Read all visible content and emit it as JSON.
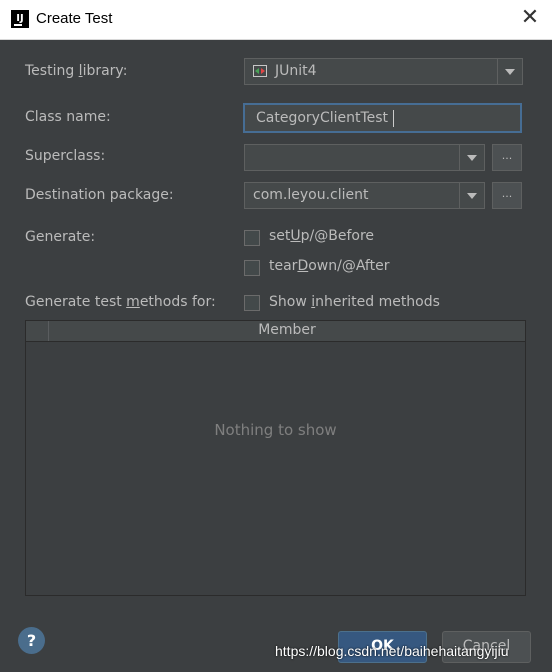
{
  "window": {
    "title": "Create Test",
    "close_glyph": "✕",
    "app_icon_letters": "IJ"
  },
  "fields": {
    "testing_library": {
      "label_pre": "Testing ",
      "label_mn": "l",
      "label_post": "ibrary:",
      "value": "JUnit4",
      "icon": "junit-icon"
    },
    "class_name": {
      "label": "Class name:",
      "value": "CategoryClientTest"
    },
    "superclass": {
      "label": "Superclass:",
      "value": "",
      "more_label": "..."
    },
    "destination_package": {
      "label": "Destination package:",
      "value": "com.leyou.client",
      "more_label": "..."
    }
  },
  "generate": {
    "label": "Generate:",
    "setup": {
      "pre": "set",
      "mn": "U",
      "post": "p/@Before",
      "checked": false
    },
    "teardown": {
      "pre": "tear",
      "mn": "D",
      "post": "own/@After",
      "checked": false
    }
  },
  "methods": {
    "label_pre": "Generate test ",
    "label_mn": "m",
    "label_post": "ethods for:",
    "show_inherited": {
      "pre": "Show ",
      "mn": "i",
      "post": "nherited methods",
      "checked": false
    }
  },
  "table": {
    "column": "Member",
    "empty_text": "Nothing to show"
  },
  "buttons": {
    "help": "?",
    "ok": "OK",
    "cancel": "Cancel"
  },
  "watermark": "https://blog.csdn.net/baihehaitangyijiu",
  "colors": {
    "background": "#3c3f41",
    "accent": "#466d94",
    "ok_button": "#365880"
  }
}
